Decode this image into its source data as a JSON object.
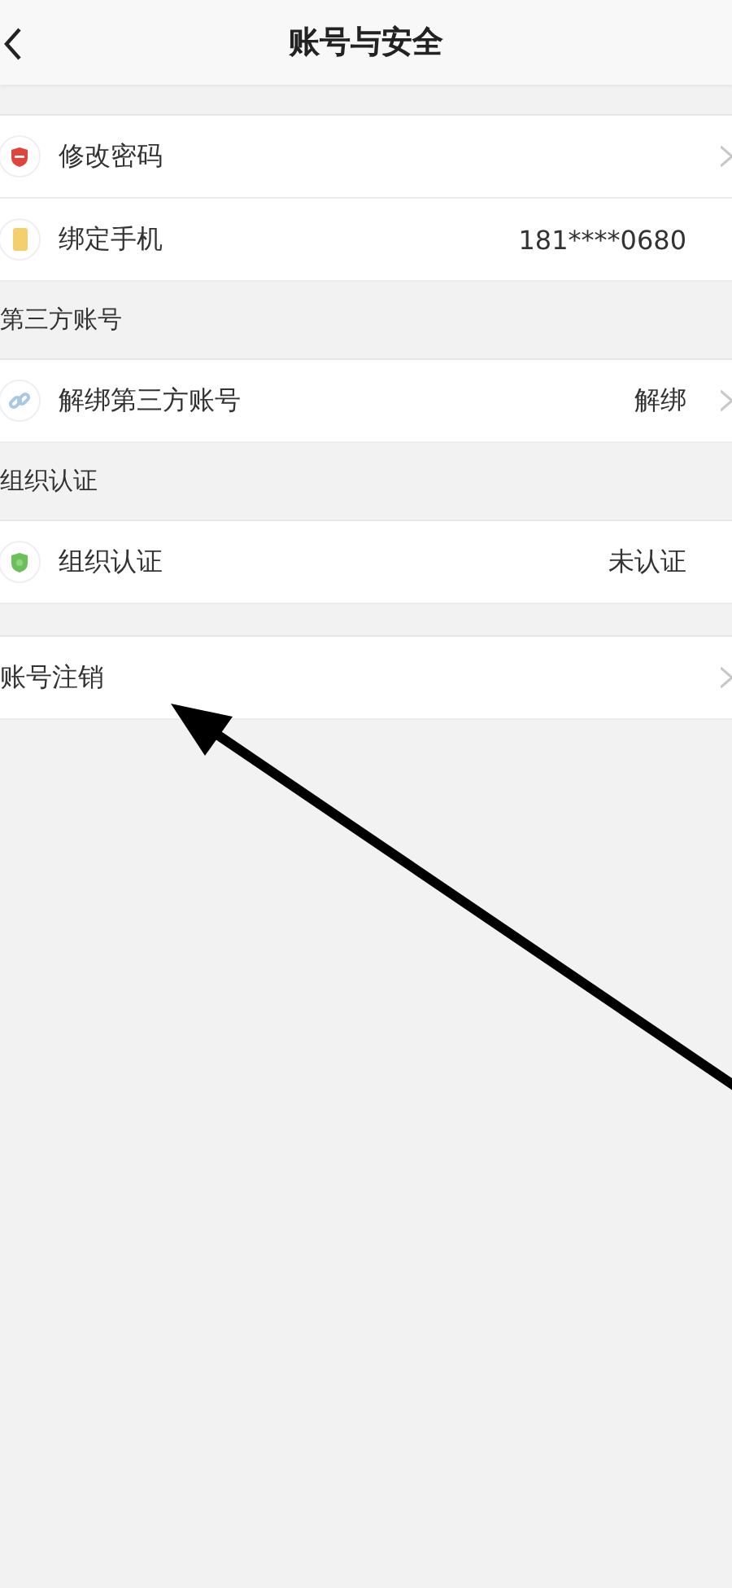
{
  "header": {
    "title": "账号与安全"
  },
  "groups": [
    {
      "rows": [
        {
          "kind": "password",
          "label": "修改密码",
          "chevron": true
        },
        {
          "kind": "phone",
          "label": "绑定手机",
          "value": "181****0680",
          "chevron": false
        }
      ]
    },
    {
      "title": "第三方账号",
      "rows": [
        {
          "kind": "link",
          "label": "解绑第三方账号",
          "value": "解绑",
          "chevron": true
        }
      ]
    },
    {
      "title": "组织认证",
      "rows": [
        {
          "kind": "verify",
          "label": "组织认证",
          "value": "未认证",
          "chevron": false
        }
      ]
    },
    {
      "rows": [
        {
          "kind": "plain",
          "label": "账号注销",
          "chevron": true
        }
      ]
    }
  ],
  "annotation": {
    "kind": "arrow"
  }
}
